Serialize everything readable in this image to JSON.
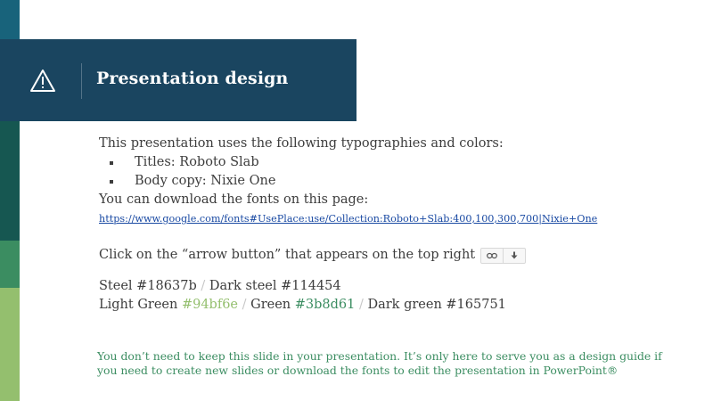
{
  "colors": {
    "steel": "#18637b",
    "dark_steel": "#114454",
    "light_green": "#94bf6e",
    "green": "#3b8d61",
    "dark_green": "#165751",
    "header_bg": "#1a4560",
    "body_text": "#3d3d3d",
    "link": "#1a4aa3",
    "divider": "#c7c7c7"
  },
  "header": {
    "icon": "warning-triangle-icon",
    "title": "Presentation design"
  },
  "body": {
    "intro": "This presentation uses the following typographies and colors:",
    "bullets": [
      {
        "text": "Titles: Roboto Slab"
      },
      {
        "text": "Body copy: Nixie One"
      }
    ],
    "download_text": "You can download the fonts on this page:",
    "link_url": "https://www.google.com/fonts#UsePlace:use/Collection:Roboto+Slab:400,100,300,700|Nixie+One",
    "arrow_text": "Click on the “arrow button” that appears on the top right",
    "arrow_widget": {
      "left_icon": "link-icon",
      "right_icon": "arrow-down-icon"
    },
    "palette_line1": [
      {
        "label": "Steel ",
        "hex": "#18637b"
      },
      {
        "label": "Dark steel ",
        "hex": "#114454"
      }
    ],
    "palette_line2": [
      {
        "label": "Light Green ",
        "hex": "#94bf6e"
      },
      {
        "label": "Green ",
        "hex": "#3b8d61"
      },
      {
        "label": "Dark green ",
        "hex": "#165751"
      }
    ],
    "separator": "/"
  },
  "footer": {
    "note": "You don’t need to keep this slide in your presentation. It’s only here to serve you as a design guide if you need to create new slides or download the fonts to edit the presentation in PowerPoint®"
  }
}
